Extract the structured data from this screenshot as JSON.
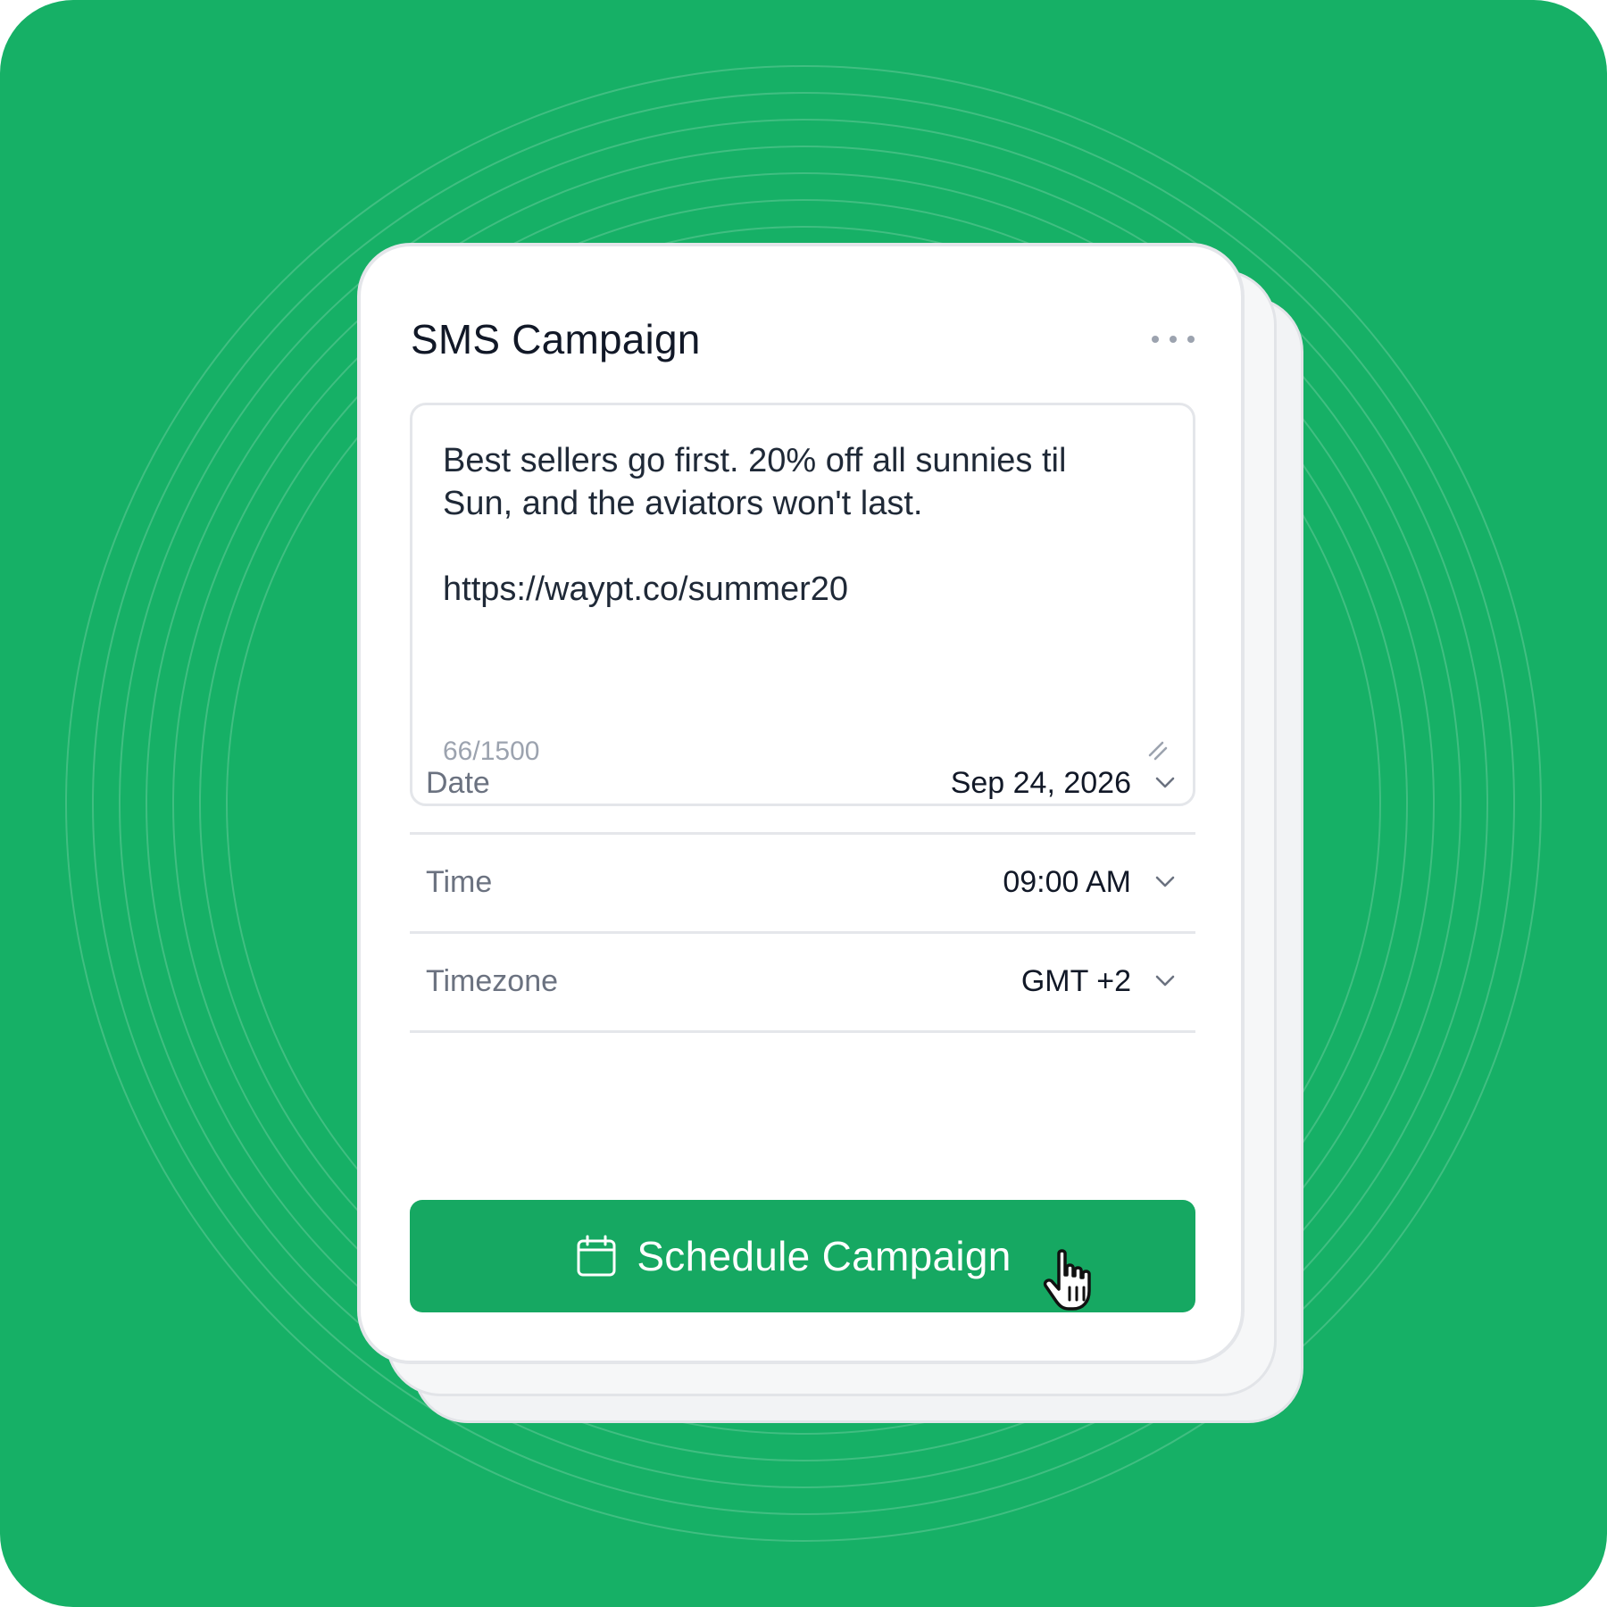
{
  "campaign": {
    "title": "SMS Campaign",
    "more_icon": "more-horizontal-icon"
  },
  "message": {
    "text": "Best sellers go first. 20% off all sunnies til\nSun, and the aviators won't last.\n\nhttps://waypt.co/summer20",
    "char_count": "66/1500",
    "resize_icon": "resize-handle-icon"
  },
  "fields": [
    {
      "label": "Date",
      "value": "Sep 24, 2026",
      "icon": "chevron-down-icon"
    },
    {
      "label": "Time",
      "value": "09:00 AM",
      "icon": "chevron-down-icon"
    },
    {
      "label": "Timezone",
      "value": "GMT +2",
      "icon": "chevron-down-icon"
    }
  ],
  "action": {
    "label": "Schedule Campaign",
    "icon": "calendar-icon",
    "cursor_icon": "pointer-hand-icon"
  },
  "colors": {
    "background": "#16b066",
    "button": "#16a862",
    "card": "#ffffff"
  }
}
